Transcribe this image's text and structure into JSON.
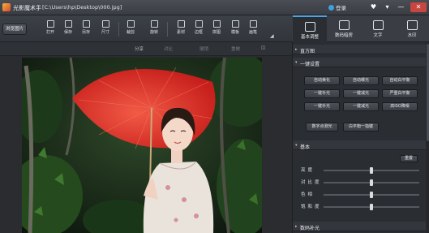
{
  "titlebar": {
    "app_name": "光影魔术手",
    "file_path": "[C:\\Users\\hp\\Desktop\\000.jpg]",
    "login_label": "登录",
    "heart_glyph": "♥",
    "menu_glyph": "▾",
    "minimize_glyph": "—",
    "close_glyph": "✕"
  },
  "toolbar": {
    "browse_label": "浏览图片",
    "tools": [
      {
        "label": "打开",
        "icon": "open-icon"
      },
      {
        "label": "保存",
        "icon": "save-icon"
      },
      {
        "label": "另存",
        "icon": "save-as-icon"
      },
      {
        "label": "尺寸",
        "icon": "resize-icon"
      },
      {
        "label": "裁剪",
        "icon": "crop-icon"
      },
      {
        "label": "旋转",
        "icon": "rotate-icon"
      },
      {
        "label": "素材",
        "icon": "material-icon"
      },
      {
        "label": "边框",
        "icon": "frame-icon"
      },
      {
        "label": "拼图",
        "icon": "collage-icon"
      },
      {
        "label": "模板",
        "icon": "template-icon"
      },
      {
        "label": "画笔",
        "icon": "brush-icon"
      }
    ],
    "more_glyph": "◢"
  },
  "subbar": {
    "share": "分享",
    "compare": "对比",
    "undo": "撤销",
    "redo": "重做",
    "zoom": "◫"
  },
  "right_tabs": [
    {
      "label": "基本调整",
      "icon": "adjust-icon",
      "active": true
    },
    {
      "label": "数码暗房",
      "icon": "darkroom-icon",
      "active": false
    },
    {
      "label": "文字",
      "icon": "text-icon",
      "active": false
    },
    {
      "label": "水印",
      "icon": "watermark-icon",
      "active": false
    }
  ],
  "panel": {
    "histogram_label": "直方图",
    "oneclick_label": "一键设置",
    "oneclick_buttons": [
      "自动美化",
      "自动曝光",
      "自动白平衡",
      "一键补光",
      "一键减光",
      "严重白平衡",
      "一键补光",
      "一键减光",
      "高ISO降噪"
    ],
    "extra_buttons": [
      "数字点测光",
      "白平衡一指键"
    ],
    "basic_label": "基本",
    "reset_label": "重置",
    "sliders": [
      {
        "label": "亮度",
        "value": 0.5
      },
      {
        "label": "对比度",
        "value": 0.5
      },
      {
        "label": "色相",
        "value": 0.5
      },
      {
        "label": "饱和度",
        "value": 0.5
      }
    ],
    "fill_light_label": "数码补光"
  },
  "colors": {
    "accent": "#4da3e6",
    "close": "#c8463f",
    "umbrella": "#e0302c"
  }
}
